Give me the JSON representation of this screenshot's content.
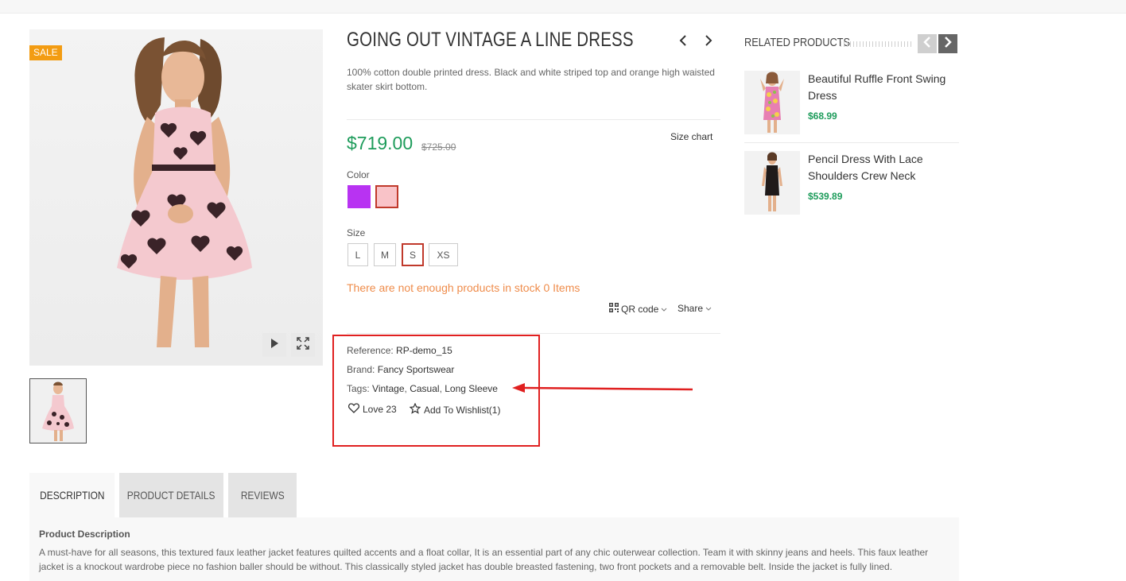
{
  "product": {
    "title": "GOING OUT VINTAGE A LINE DRESS",
    "short_description": "100% cotton double printed dress. Black and white striped top and orange high waisted skater skirt bottom.",
    "sale_badge": "SALE",
    "price": "$719.00",
    "old_price": "$725.00",
    "size_chart_label": "Size chart",
    "color_label": "Color",
    "colors": [
      "#b833f2",
      "#f9c3c8"
    ],
    "selected_color_index": 1,
    "size_label": "Size",
    "sizes": [
      "L",
      "M",
      "S",
      "XS"
    ],
    "selected_size": "S",
    "stock_warning": "There are not enough products in stock 0 Items",
    "qr_label": "QR code",
    "share_label": "Share",
    "reference_label": "Reference:",
    "reference_value": "RP-demo_15",
    "brand_label": "Brand:",
    "brand_value": "Fancy Sportswear",
    "tags_label": "Tags:",
    "tags": [
      "Vintage",
      "Casual",
      "Long Sleeve"
    ],
    "tag_separator": ",",
    "love_label": "Love 23",
    "wishlist_label": "Add To Wishlist(1)"
  },
  "related": {
    "title": "RELATED PRODUCTS",
    "items": [
      {
        "name": "Beautiful Ruffle Front Swing Dress",
        "price": "$68.99"
      },
      {
        "name": "Pencil Dress With Lace Shoulders Crew Neck",
        "price": "$539.89"
      }
    ]
  },
  "tabs": {
    "items": [
      "DESCRIPTION",
      "PRODUCT DETAILS",
      "REVIEWS"
    ],
    "active": "DESCRIPTION",
    "panel_heading": "Product Description",
    "panel_text": "A must-have for all seasons, this textured faux leather jacket features quilted accents and a float collar, It is an essential part of any chic outerwear collection. Team it with skinny jeans and heels. This faux leather jacket is a knockout wardrobe piece no fashion baller should be without. This classically styled jacket has double breasted fastening, two front pockets and a removable belt. Inside the jacket is fully lined."
  },
  "colors": {
    "price_green": "#1e9c5b",
    "warning_orange": "#ef8c4b",
    "sale_orange": "#f39c12",
    "annotation_red": "#e02020"
  },
  "icons": [
    "play-icon",
    "fullscreen-icon",
    "chevron-left-icon",
    "chevron-right-icon",
    "qr-code-icon",
    "heart-icon",
    "star-icon"
  ]
}
